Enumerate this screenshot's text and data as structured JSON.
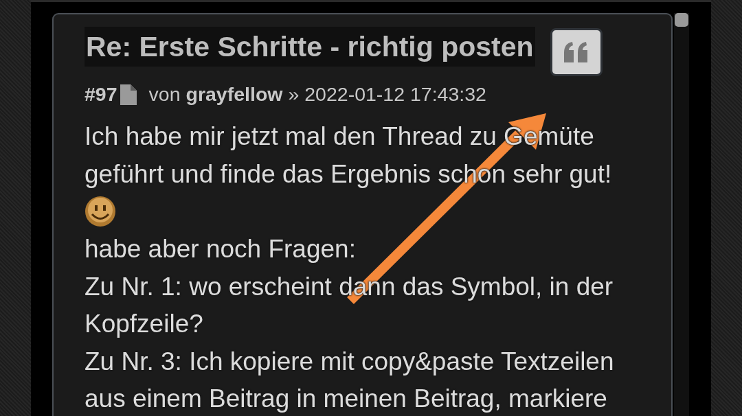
{
  "post": {
    "title": "Re: Erste Schritte - richtig posten",
    "number": "#97",
    "by": "von",
    "author": "grayfellow",
    "separator": "»",
    "timestamp": "2022-01-12 17:43:32",
    "body": [
      {
        "kind": "text",
        "lines": [
          "Ich habe mir jetzt mal den Thread zu Gemüte",
          "geführt und finde das Ergebnis schon sehr gut!"
        ]
      },
      {
        "kind": "smiley"
      },
      {
        "kind": "text",
        "lines": [
          "habe aber noch Fragen:"
        ]
      },
      {
        "kind": "text",
        "lines": [
          "Zu Nr. 1: wo erscheint dann das Symbol, in der",
          "Kopfzeile?"
        ]
      },
      {
        "kind": "text",
        "lines": [
          "Zu Nr. 3: Ich kopiere mit copy&paste Textzeilen",
          "aus einem Beitrag in meinen Beitrag, markiere"
        ]
      }
    ]
  }
}
